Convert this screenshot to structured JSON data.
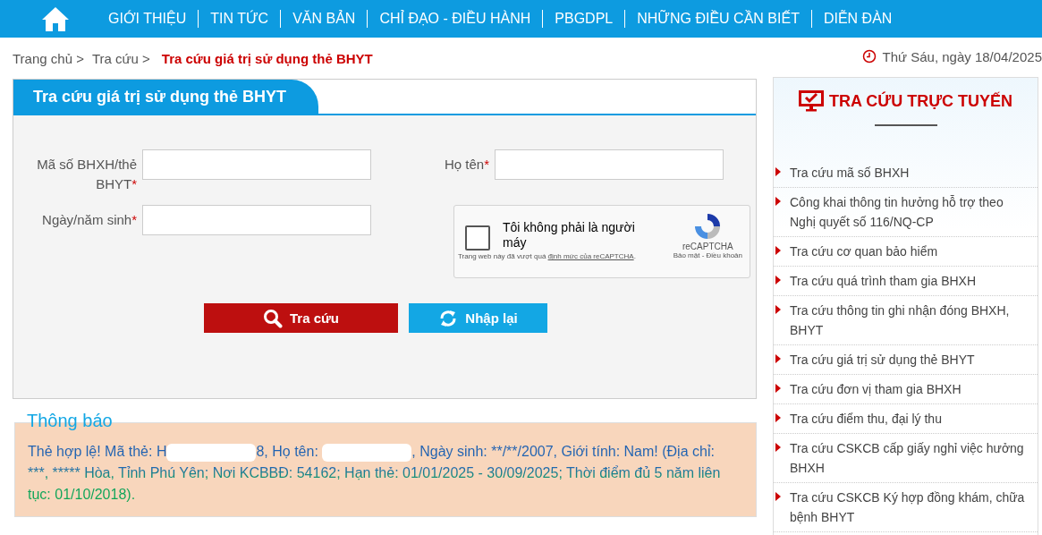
{
  "nav": {
    "items": [
      "GIỚI THIỆU",
      "TIN TỨC",
      "VĂN BẢN",
      "CHỈ ĐẠO - ĐIỀU HÀNH",
      "PBGDPL",
      "NHỮNG ĐIỀU CẦN BIẾT",
      "DIỄN ĐÀN"
    ]
  },
  "breadcrumb": {
    "items": [
      "Trang chủ >",
      "Tra cứu >"
    ],
    "current": "Tra cứu giá trị sử dụng thẻ BHYT"
  },
  "date": "Thứ Sáu, ngày 18/04/2025",
  "form": {
    "title": "Tra cứu giá trị sử dụng thẻ BHYT",
    "fields": [
      {
        "label": "Mã số BHXH/thẻ BHYT",
        "required_mark": "*"
      },
      {
        "label": "Họ tên",
        "required_mark": "*"
      },
      {
        "label": "Ngày/năm sinh",
        "required_mark": "*"
      }
    ],
    "captcha": {
      "label": "Tôi không phải là người máy",
      "checked": false,
      "note": "Trang web này đã vượt quá ",
      "note_link": "định mức của reCAPTCHA",
      "note_end": ".",
      "brand": "reCAPTCHA",
      "links": "Bảo mật - Điều khoản"
    },
    "buttons": [
      {
        "kind": "search",
        "label": "Tra cứu"
      },
      {
        "kind": "reset",
        "label": "Nhập lại"
      }
    ]
  },
  "notice": {
    "title": "Thông báo",
    "parts": [
      {
        "kind": "text",
        "text": "Thẻ hợp lệ! Mã thẻ: H"
      },
      {
        "kind": "redacted"
      },
      {
        "kind": "text",
        "text": "8, Họ tên: "
      },
      {
        "kind": "redacted"
      },
      {
        "kind": "text",
        "text": ", Ngày sinh: **/**/2007, Giới tính: Nam! (Địa chỉ: ***, ***** Hòa, Tỉnh Phú Yên; Nơi KCBBĐ: 54162; Hạn thẻ: 01/01/2025 - 30/09/2025; Thời điểm đủ 5 năm liên tục: 01/10/2018)."
      }
    ]
  },
  "sidebar": {
    "title": "TRA CỨU TRỰC TUYẾN",
    "items": [
      "Tra cứu mã số BHXH",
      "Công khai thông tin hưởng hỗ trợ theo Nghị quyết số 116/NQ-CP",
      "Tra cứu cơ quan bảo hiểm",
      "Tra cứu quá trình tham gia BHXH",
      "Tra cứu thông tin ghi nhận đóng BHXH, BHYT",
      "Tra cứu giá trị sử dụng thẻ BHYT",
      "Tra cứu đơn vị tham gia BHXH",
      "Tra cứu điểm thu, đại lý thu",
      "Tra cứu CSKCB cấp giấy nghỉ việc hưởng BHXH",
      "Tra cứu CSKCB Ký hợp đồng khám, chữa bệnh BHYT"
    ]
  }
}
